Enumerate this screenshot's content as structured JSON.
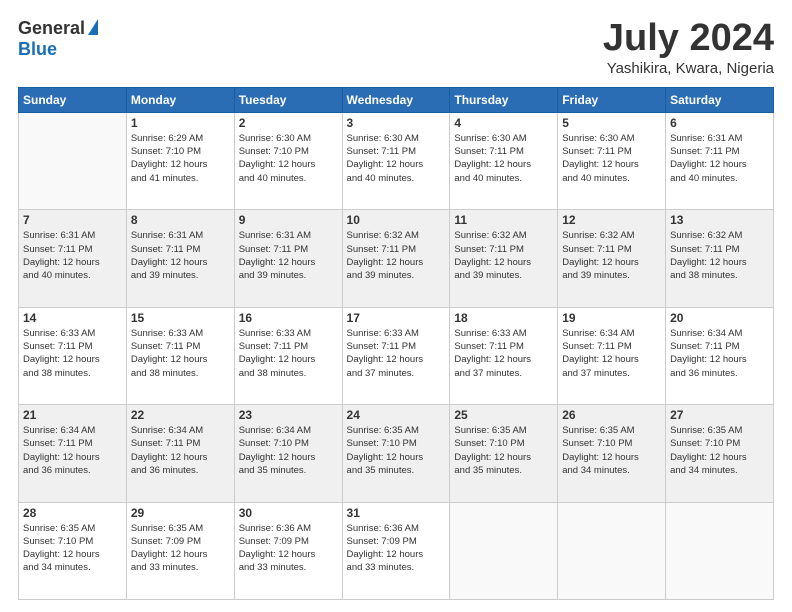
{
  "header": {
    "logo_general": "General",
    "logo_blue": "Blue",
    "month_title": "July 2024",
    "location": "Yashikira, Kwara, Nigeria"
  },
  "days_of_week": [
    "Sunday",
    "Monday",
    "Tuesday",
    "Wednesday",
    "Thursday",
    "Friday",
    "Saturday"
  ],
  "weeks": [
    [
      {
        "day": "",
        "info": ""
      },
      {
        "day": "1",
        "info": "Sunrise: 6:29 AM\nSunset: 7:10 PM\nDaylight: 12 hours\nand 41 minutes."
      },
      {
        "day": "2",
        "info": "Sunrise: 6:30 AM\nSunset: 7:10 PM\nDaylight: 12 hours\nand 40 minutes."
      },
      {
        "day": "3",
        "info": "Sunrise: 6:30 AM\nSunset: 7:11 PM\nDaylight: 12 hours\nand 40 minutes."
      },
      {
        "day": "4",
        "info": "Sunrise: 6:30 AM\nSunset: 7:11 PM\nDaylight: 12 hours\nand 40 minutes."
      },
      {
        "day": "5",
        "info": "Sunrise: 6:30 AM\nSunset: 7:11 PM\nDaylight: 12 hours\nand 40 minutes."
      },
      {
        "day": "6",
        "info": "Sunrise: 6:31 AM\nSunset: 7:11 PM\nDaylight: 12 hours\nand 40 minutes."
      }
    ],
    [
      {
        "day": "7",
        "info": "Sunrise: 6:31 AM\nSunset: 7:11 PM\nDaylight: 12 hours\nand 40 minutes."
      },
      {
        "day": "8",
        "info": "Sunrise: 6:31 AM\nSunset: 7:11 PM\nDaylight: 12 hours\nand 39 minutes."
      },
      {
        "day": "9",
        "info": "Sunrise: 6:31 AM\nSunset: 7:11 PM\nDaylight: 12 hours\nand 39 minutes."
      },
      {
        "day": "10",
        "info": "Sunrise: 6:32 AM\nSunset: 7:11 PM\nDaylight: 12 hours\nand 39 minutes."
      },
      {
        "day": "11",
        "info": "Sunrise: 6:32 AM\nSunset: 7:11 PM\nDaylight: 12 hours\nand 39 minutes."
      },
      {
        "day": "12",
        "info": "Sunrise: 6:32 AM\nSunset: 7:11 PM\nDaylight: 12 hours\nand 39 minutes."
      },
      {
        "day": "13",
        "info": "Sunrise: 6:32 AM\nSunset: 7:11 PM\nDaylight: 12 hours\nand 38 minutes."
      }
    ],
    [
      {
        "day": "14",
        "info": "Sunrise: 6:33 AM\nSunset: 7:11 PM\nDaylight: 12 hours\nand 38 minutes."
      },
      {
        "day": "15",
        "info": "Sunrise: 6:33 AM\nSunset: 7:11 PM\nDaylight: 12 hours\nand 38 minutes."
      },
      {
        "day": "16",
        "info": "Sunrise: 6:33 AM\nSunset: 7:11 PM\nDaylight: 12 hours\nand 38 minutes."
      },
      {
        "day": "17",
        "info": "Sunrise: 6:33 AM\nSunset: 7:11 PM\nDaylight: 12 hours\nand 37 minutes."
      },
      {
        "day": "18",
        "info": "Sunrise: 6:33 AM\nSunset: 7:11 PM\nDaylight: 12 hours\nand 37 minutes."
      },
      {
        "day": "19",
        "info": "Sunrise: 6:34 AM\nSunset: 7:11 PM\nDaylight: 12 hours\nand 37 minutes."
      },
      {
        "day": "20",
        "info": "Sunrise: 6:34 AM\nSunset: 7:11 PM\nDaylight: 12 hours\nand 36 minutes."
      }
    ],
    [
      {
        "day": "21",
        "info": "Sunrise: 6:34 AM\nSunset: 7:11 PM\nDaylight: 12 hours\nand 36 minutes."
      },
      {
        "day": "22",
        "info": "Sunrise: 6:34 AM\nSunset: 7:11 PM\nDaylight: 12 hours\nand 36 minutes."
      },
      {
        "day": "23",
        "info": "Sunrise: 6:34 AM\nSunset: 7:10 PM\nDaylight: 12 hours\nand 35 minutes."
      },
      {
        "day": "24",
        "info": "Sunrise: 6:35 AM\nSunset: 7:10 PM\nDaylight: 12 hours\nand 35 minutes."
      },
      {
        "day": "25",
        "info": "Sunrise: 6:35 AM\nSunset: 7:10 PM\nDaylight: 12 hours\nand 35 minutes."
      },
      {
        "day": "26",
        "info": "Sunrise: 6:35 AM\nSunset: 7:10 PM\nDaylight: 12 hours\nand 34 minutes."
      },
      {
        "day": "27",
        "info": "Sunrise: 6:35 AM\nSunset: 7:10 PM\nDaylight: 12 hours\nand 34 minutes."
      }
    ],
    [
      {
        "day": "28",
        "info": "Sunrise: 6:35 AM\nSunset: 7:10 PM\nDaylight: 12 hours\nand 34 minutes."
      },
      {
        "day": "29",
        "info": "Sunrise: 6:35 AM\nSunset: 7:09 PM\nDaylight: 12 hours\nand 33 minutes."
      },
      {
        "day": "30",
        "info": "Sunrise: 6:36 AM\nSunset: 7:09 PM\nDaylight: 12 hours\nand 33 minutes."
      },
      {
        "day": "31",
        "info": "Sunrise: 6:36 AM\nSunset: 7:09 PM\nDaylight: 12 hours\nand 33 minutes."
      },
      {
        "day": "",
        "info": ""
      },
      {
        "day": "",
        "info": ""
      },
      {
        "day": "",
        "info": ""
      }
    ]
  ]
}
